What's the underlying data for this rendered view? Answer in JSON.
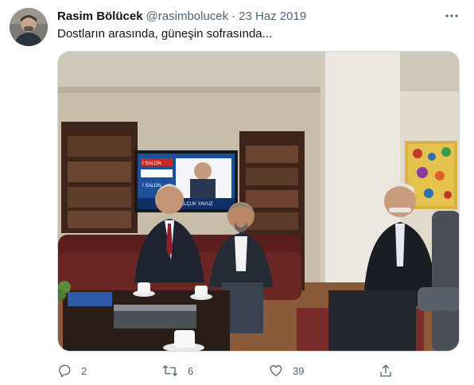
{
  "tweet": {
    "display_name": "Rasim Bölücek",
    "handle": "@rasimbolucek",
    "separator": "·",
    "date": "23 Haz 2019",
    "text": "Dostların arasında, güneşin sofrasında...",
    "media": {
      "tv_screen": {
        "caption_a": "İ SALON",
        "caption_b": "SELÇUK YAVUZ",
        "caption_c": "İ SALON"
      }
    }
  },
  "actions": {
    "reply": {
      "icon": "reply-icon",
      "count": "2"
    },
    "retweet": {
      "icon": "retweet-icon",
      "count": "6"
    },
    "like": {
      "icon": "heart-icon",
      "count": "39"
    },
    "share": {
      "icon": "share-icon"
    }
  },
  "colors": {
    "text_primary": "#0f1419",
    "text_secondary": "#536471",
    "border": "#cfd9de"
  }
}
